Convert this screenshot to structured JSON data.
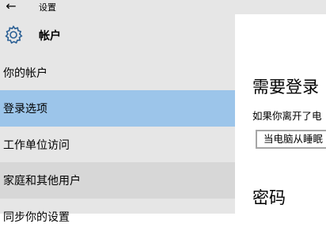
{
  "window": {
    "back_icon": "back-arrow-icon",
    "title": "设置"
  },
  "sidebar": {
    "section_icon": "gear-icon",
    "section_title": "帐户",
    "items": [
      {
        "label": "你的帐户"
      },
      {
        "label": "登录选项"
      },
      {
        "label": "工作单位访问"
      },
      {
        "label": "家庭和其他用户"
      },
      {
        "label": "同步你的设置"
      }
    ]
  },
  "main": {
    "heading": "需要登录",
    "description": "如果你离开了电",
    "dropdown_value": "当电脑从睡眠",
    "password_heading": "密码"
  },
  "colors": {
    "selected": "#9cc5ea",
    "sidebar_bg": "#e6e6e6",
    "hover": "#d7d7d7"
  }
}
